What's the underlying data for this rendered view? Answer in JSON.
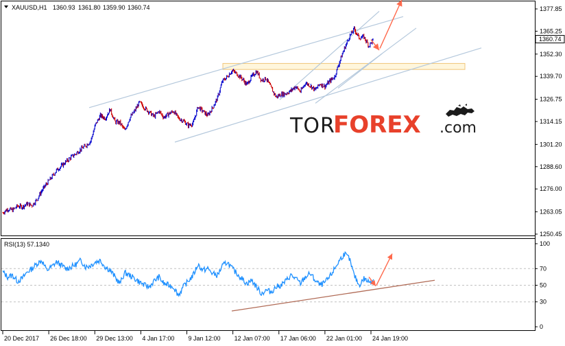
{
  "header": {
    "symbol_label": "XAUUSD,H1",
    "open": "1360.93",
    "high": "1361.80",
    "low": "1359.90",
    "close": "1360.74"
  },
  "rsi_header": "RSI(13) 57.1340",
  "logo": {
    "part1": "TOR",
    "part2": "FOREX",
    "part3": ".com"
  },
  "colors": {
    "up_candle": "#0000cc",
    "down_candle": "#cc0000",
    "rsi_line": "#1e90ff",
    "channel_line": "#b4c8dc",
    "zone_fill": "#fff6dc",
    "zone_border": "#f0c678",
    "arrow": "#ff6a4d",
    "rsi_trendline": "#b06a55",
    "logo_red": "#e8412b"
  },
  "chart_data": [
    {
      "type": "line",
      "name": "price",
      "x_tick_labels": [
        "20 Dec 2017",
        "26 Dec 18:00",
        "29 Dec 13:00",
        "4 Jan 17:00",
        "9 Jan 12:00",
        "12 Jan 07:00",
        "17 Jan 06:00",
        "22 Jan 01:00",
        "24 Jan 19:00"
      ],
      "y_tick_labels": [
        "1377.85",
        "1365.25",
        "1352.30",
        "1339.70",
        "1326.75",
        "1314.15",
        "1301.20",
        "1288.60",
        "1276.00",
        "1263.05",
        "1250.45"
      ],
      "ylim": [
        1250.45,
        1377.85
      ],
      "current_price_label": "1360.74",
      "series": [
        {
          "values": [
            1262.5,
            1264.6,
            1264.0,
            1266.3,
            1265.9,
            1267.6,
            1266.7,
            1270.0,
            1275.0,
            1279.0,
            1282.5,
            1286.5,
            1289.0,
            1291.5,
            1294.0,
            1296.0,
            1298.5,
            1300.5,
            1303.0,
            1312.5,
            1317.5,
            1316.0,
            1321.0,
            1314.0,
            1313.5,
            1309.0,
            1316.0,
            1320.0,
            1325.0,
            1322.0,
            1319.5,
            1317.0,
            1320.0,
            1316.5,
            1318.5,
            1320.0,
            1316.0,
            1314.5,
            1312.0,
            1313.0,
            1322.5,
            1320.0,
            1317.5,
            1322.0,
            1327.5,
            1337.0,
            1339.5,
            1343.0,
            1341.0,
            1338.5,
            1335.0,
            1339.5,
            1342.5,
            1337.5,
            1338.5,
            1333.0,
            1328.0,
            1329.5,
            1330.0,
            1331.5,
            1334.0,
            1331.0,
            1336.0,
            1334.5,
            1332.0,
            1335.5,
            1334.0,
            1337.0,
            1339.5,
            1348.0,
            1355.5,
            1362.0,
            1366.5,
            1361.5,
            1362.0,
            1357.0,
            1360.7
          ]
        }
      ],
      "annotations": [
        "ascending channel",
        "resistance zone near 1343-1347",
        "projection arrows down then up"
      ]
    },
    {
      "type": "line",
      "name": "RSI(13)",
      "y_tick_labels": [
        "100",
        "70",
        "50",
        "30",
        "0"
      ],
      "ylim": [
        0,
        100
      ],
      "levels": [
        70,
        50,
        30
      ],
      "series": [
        {
          "values": [
            66,
            60,
            62,
            55,
            58,
            66,
            70,
            76,
            80,
            68,
            72,
            78,
            74,
            70,
            72,
            75,
            80,
            72,
            74,
            78,
            80,
            72,
            68,
            60,
            52,
            65,
            62,
            58,
            54,
            50,
            48,
            55,
            60,
            52,
            50,
            48,
            38,
            48,
            55,
            62,
            75,
            68,
            70,
            64,
            62,
            73,
            78,
            70,
            64,
            58,
            52,
            56,
            48,
            40,
            44,
            42,
            48,
            50,
            55,
            62,
            58,
            52,
            60,
            64,
            56,
            50,
            53,
            60,
            70,
            80,
            88,
            82,
            62,
            50,
            58,
            54,
            57
          ]
        }
      ]
    }
  ]
}
